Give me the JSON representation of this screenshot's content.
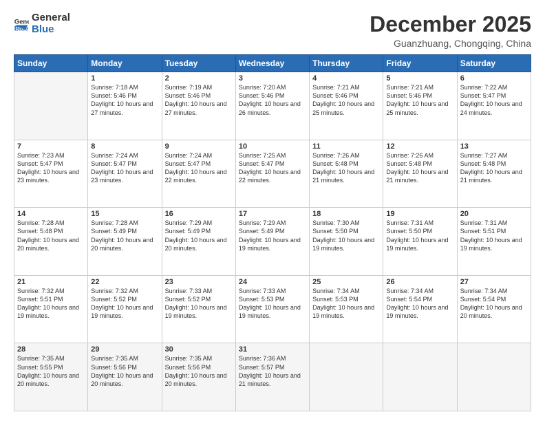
{
  "logo": {
    "general": "General",
    "blue": "Blue"
  },
  "header": {
    "month": "December 2025",
    "location": "Guanzhuang, Chongqing, China"
  },
  "days": [
    "Sunday",
    "Monday",
    "Tuesday",
    "Wednesday",
    "Thursday",
    "Friday",
    "Saturday"
  ],
  "weeks": [
    [
      {
        "day": "",
        "sunrise": "",
        "sunset": "",
        "daylight": ""
      },
      {
        "day": "1",
        "sunrise": "Sunrise: 7:18 AM",
        "sunset": "Sunset: 5:46 PM",
        "daylight": "Daylight: 10 hours and 27 minutes."
      },
      {
        "day": "2",
        "sunrise": "Sunrise: 7:19 AM",
        "sunset": "Sunset: 5:46 PM",
        "daylight": "Daylight: 10 hours and 27 minutes."
      },
      {
        "day": "3",
        "sunrise": "Sunrise: 7:20 AM",
        "sunset": "Sunset: 5:46 PM",
        "daylight": "Daylight: 10 hours and 26 minutes."
      },
      {
        "day": "4",
        "sunrise": "Sunrise: 7:21 AM",
        "sunset": "Sunset: 5:46 PM",
        "daylight": "Daylight: 10 hours and 25 minutes."
      },
      {
        "day": "5",
        "sunrise": "Sunrise: 7:21 AM",
        "sunset": "Sunset: 5:46 PM",
        "daylight": "Daylight: 10 hours and 25 minutes."
      },
      {
        "day": "6",
        "sunrise": "Sunrise: 7:22 AM",
        "sunset": "Sunset: 5:47 PM",
        "daylight": "Daylight: 10 hours and 24 minutes."
      }
    ],
    [
      {
        "day": "7",
        "sunrise": "Sunrise: 7:23 AM",
        "sunset": "Sunset: 5:47 PM",
        "daylight": "Daylight: 10 hours and 23 minutes."
      },
      {
        "day": "8",
        "sunrise": "Sunrise: 7:24 AM",
        "sunset": "Sunset: 5:47 PM",
        "daylight": "Daylight: 10 hours and 23 minutes."
      },
      {
        "day": "9",
        "sunrise": "Sunrise: 7:24 AM",
        "sunset": "Sunset: 5:47 PM",
        "daylight": "Daylight: 10 hours and 22 minutes."
      },
      {
        "day": "10",
        "sunrise": "Sunrise: 7:25 AM",
        "sunset": "Sunset: 5:47 PM",
        "daylight": "Daylight: 10 hours and 22 minutes."
      },
      {
        "day": "11",
        "sunrise": "Sunrise: 7:26 AM",
        "sunset": "Sunset: 5:48 PM",
        "daylight": "Daylight: 10 hours and 21 minutes."
      },
      {
        "day": "12",
        "sunrise": "Sunrise: 7:26 AM",
        "sunset": "Sunset: 5:48 PM",
        "daylight": "Daylight: 10 hours and 21 minutes."
      },
      {
        "day": "13",
        "sunrise": "Sunrise: 7:27 AM",
        "sunset": "Sunset: 5:48 PM",
        "daylight": "Daylight: 10 hours and 21 minutes."
      }
    ],
    [
      {
        "day": "14",
        "sunrise": "Sunrise: 7:28 AM",
        "sunset": "Sunset: 5:48 PM",
        "daylight": "Daylight: 10 hours and 20 minutes."
      },
      {
        "day": "15",
        "sunrise": "Sunrise: 7:28 AM",
        "sunset": "Sunset: 5:49 PM",
        "daylight": "Daylight: 10 hours and 20 minutes."
      },
      {
        "day": "16",
        "sunrise": "Sunrise: 7:29 AM",
        "sunset": "Sunset: 5:49 PM",
        "daylight": "Daylight: 10 hours and 20 minutes."
      },
      {
        "day": "17",
        "sunrise": "Sunrise: 7:29 AM",
        "sunset": "Sunset: 5:49 PM",
        "daylight": "Daylight: 10 hours and 19 minutes."
      },
      {
        "day": "18",
        "sunrise": "Sunrise: 7:30 AM",
        "sunset": "Sunset: 5:50 PM",
        "daylight": "Daylight: 10 hours and 19 minutes."
      },
      {
        "day": "19",
        "sunrise": "Sunrise: 7:31 AM",
        "sunset": "Sunset: 5:50 PM",
        "daylight": "Daylight: 10 hours and 19 minutes."
      },
      {
        "day": "20",
        "sunrise": "Sunrise: 7:31 AM",
        "sunset": "Sunset: 5:51 PM",
        "daylight": "Daylight: 10 hours and 19 minutes."
      }
    ],
    [
      {
        "day": "21",
        "sunrise": "Sunrise: 7:32 AM",
        "sunset": "Sunset: 5:51 PM",
        "daylight": "Daylight: 10 hours and 19 minutes."
      },
      {
        "day": "22",
        "sunrise": "Sunrise: 7:32 AM",
        "sunset": "Sunset: 5:52 PM",
        "daylight": "Daylight: 10 hours and 19 minutes."
      },
      {
        "day": "23",
        "sunrise": "Sunrise: 7:33 AM",
        "sunset": "Sunset: 5:52 PM",
        "daylight": "Daylight: 10 hours and 19 minutes."
      },
      {
        "day": "24",
        "sunrise": "Sunrise: 7:33 AM",
        "sunset": "Sunset: 5:53 PM",
        "daylight": "Daylight: 10 hours and 19 minutes."
      },
      {
        "day": "25",
        "sunrise": "Sunrise: 7:34 AM",
        "sunset": "Sunset: 5:53 PM",
        "daylight": "Daylight: 10 hours and 19 minutes."
      },
      {
        "day": "26",
        "sunrise": "Sunrise: 7:34 AM",
        "sunset": "Sunset: 5:54 PM",
        "daylight": "Daylight: 10 hours and 19 minutes."
      },
      {
        "day": "27",
        "sunrise": "Sunrise: 7:34 AM",
        "sunset": "Sunset: 5:54 PM",
        "daylight": "Daylight: 10 hours and 20 minutes."
      }
    ],
    [
      {
        "day": "28",
        "sunrise": "Sunrise: 7:35 AM",
        "sunset": "Sunset: 5:55 PM",
        "daylight": "Daylight: 10 hours and 20 minutes."
      },
      {
        "day": "29",
        "sunrise": "Sunrise: 7:35 AM",
        "sunset": "Sunset: 5:56 PM",
        "daylight": "Daylight: 10 hours and 20 minutes."
      },
      {
        "day": "30",
        "sunrise": "Sunrise: 7:35 AM",
        "sunset": "Sunset: 5:56 PM",
        "daylight": "Daylight: 10 hours and 20 minutes."
      },
      {
        "day": "31",
        "sunrise": "Sunrise: 7:36 AM",
        "sunset": "Sunset: 5:57 PM",
        "daylight": "Daylight: 10 hours and 21 minutes."
      },
      {
        "day": "",
        "sunrise": "",
        "sunset": "",
        "daylight": ""
      },
      {
        "day": "",
        "sunrise": "",
        "sunset": "",
        "daylight": ""
      },
      {
        "day": "",
        "sunrise": "",
        "sunset": "",
        "daylight": ""
      }
    ]
  ]
}
